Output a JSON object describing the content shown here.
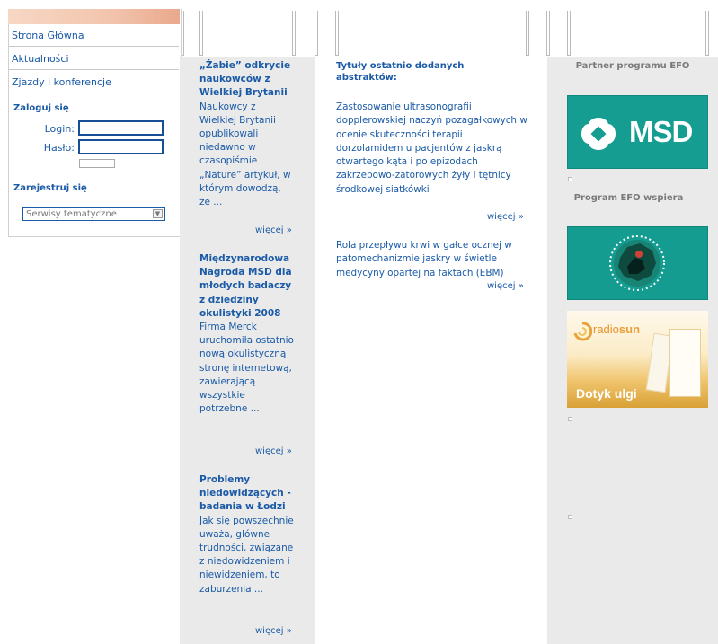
{
  "menu": {
    "items": [
      {
        "label": "Strona Główna"
      },
      {
        "label": "Aktualności"
      },
      {
        "label": "Zjazdy i konferencje"
      }
    ]
  },
  "login": {
    "title": "Zaloguj się",
    "login_label": "Login:",
    "password_label": "Hasło:",
    "register": "Zarejestruj się",
    "select_value": "Serwisy tematyczne"
  },
  "news": [
    {
      "title": "„Żabie” odkrycie naukowców z Wielkiej Brytanii",
      "body": "Naukowcy z Wielkiej Brytanii opublikowali niedawno w czasopiśmie „Nature” artykuł, w którym dowodzą, że ...",
      "more": "więcej »"
    },
    {
      "title": "Międzynarodowa Nagroda MSD dla młodych badaczy z dziedziny okulistyki 2008",
      "body": "Firma Merck uruchomiła ostatnio nową okulistyczną stronę internetową, zawierającą wszystkie potrzebne ...",
      "more": "więcej »"
    },
    {
      "title": "Problemy niedowidzących - badania w Łodzi",
      "body": "Jak się powszechnie uważa, główne trudności, związane z niedowidzeniem i niewidzeniem, to zaburzenia ...",
      "more": "więcej »"
    }
  ],
  "abstracts": {
    "title": "Tytuły ostatnio dodanych abstraktów:",
    "items": [
      {
        "text": "Zastosowanie ultrasonografii dopplerowskiej naczyń pozagałkowych w ocenie skuteczności terapii dorzolamidem u pacjentów z jaskrą otwartego kąta i po epizodach zakrzepowo-zatorowych żyły i tętnicy środkowej siatkówki",
        "more": "więcej »"
      },
      {
        "text": "Rola przepływu krwi w gałce ocznej w patomechanizmie jaskry w świetle medycyny opartej na faktach (EBM)",
        "more": "więcej »"
      }
    ]
  },
  "sidebar": {
    "partner_title": "Partner programu EFO",
    "msd_logo_text": "MSD",
    "support_title": "Program EFO wspiera",
    "radiosun_name_1": "radio",
    "radiosun_name_2": "sun",
    "radiosun_slogan": "Dotyk ulgi"
  },
  "colors": {
    "link": "#1a5aa6",
    "column_bg": "#eaeaea",
    "msd_teal": "#159d92",
    "muted": "#7a7a7a"
  }
}
